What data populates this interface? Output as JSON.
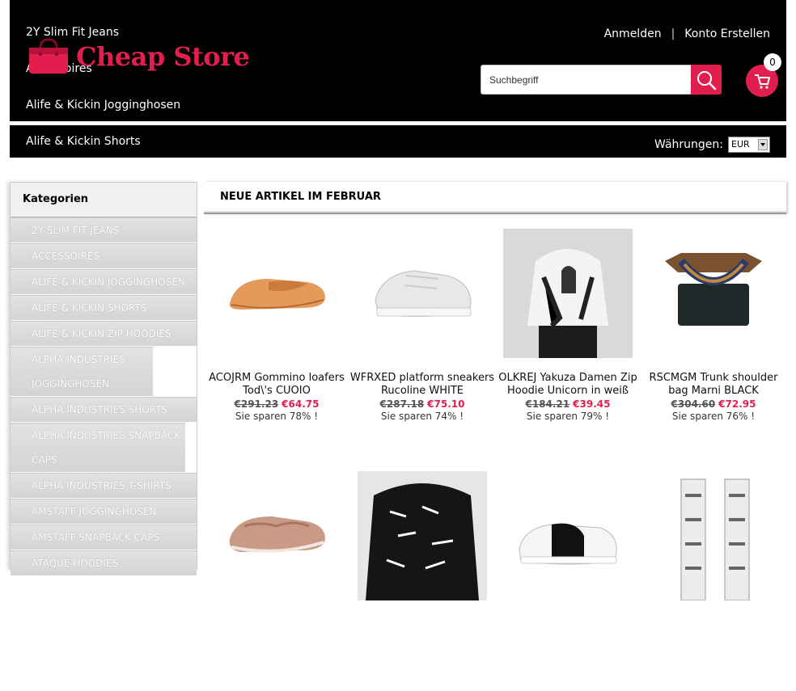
{
  "header": {
    "top_links": [
      "2Y Slim Fit Jeans",
      "Accessoires",
      "Alife & Kickin Jogginghosen",
      "Alife & Kickin Shorts"
    ],
    "logo_text": "Cheap Store",
    "login": "Anmelden",
    "register": "Konto Erstellen",
    "search_placeholder": "Suchbegriff",
    "cart_count": "0",
    "currency_label": "Währungen:",
    "currency_value": "EUR"
  },
  "colors": {
    "accent": "#e21e4f",
    "header_bg": "#000000"
  },
  "sidebar": {
    "title": "Kategorien",
    "items": [
      "2Y Slim Fit Jeans",
      "Accessoires",
      "Alife & Kickin Jogginghosen",
      "Alife & Kickin Shorts",
      "Alife & Kickin Zip Hoodies",
      "Alpha Industries Jogginghosen",
      "Alpha Industries Shorts",
      "Alpha Industries Snapback Caps",
      "Alpha Industries T-Shirts",
      "Amstaff Jogginghosen",
      "Amstaff Snapback Caps",
      "Ataque Hoodies"
    ]
  },
  "main": {
    "title": "NEUE ARTIKEL IM FEBRUAR",
    "products": [
      {
        "name": "ACOJRM Gommino loafers Tod\\'s CUOIO",
        "old_price": "€291.23",
        "new_price": "€64.75",
        "save": "Sie sparen 78% !",
        "image": "tan-loafer-icon"
      },
      {
        "name": "WFRXED platform sneakers Rucoline WHITE",
        "old_price": "€287.18",
        "new_price": "€75.10",
        "save": "Sie sparen 74% !",
        "image": "white-sneaker-icon"
      },
      {
        "name": "OLKREJ Yakuza Damen Zip Hoodie Unicorn in weiß",
        "old_price": "€184.21",
        "new_price": "€39.45",
        "save": "Sie sparen 79% !",
        "image": "hoodie-model-photo"
      },
      {
        "name": "RSCMGM Trunk shoulder bag Marni BLACK",
        "old_price": "€304.60",
        "new_price": "€72.95",
        "save": "Sie sparen 76% !",
        "image": "shoulder-bag-icon"
      },
      {
        "name": "",
        "old_price": "",
        "new_price": "",
        "save": "",
        "image": "pink-loafer-icon"
      },
      {
        "name": "",
        "old_price": "",
        "new_price": "",
        "save": "",
        "image": "printed-sweater-photo"
      },
      {
        "name": "",
        "old_price": "",
        "new_price": "",
        "save": "",
        "image": "black-white-sneaker-icon"
      },
      {
        "name": "",
        "old_price": "",
        "new_price": "",
        "save": "",
        "image": "crystal-earrings-icon"
      }
    ]
  }
}
